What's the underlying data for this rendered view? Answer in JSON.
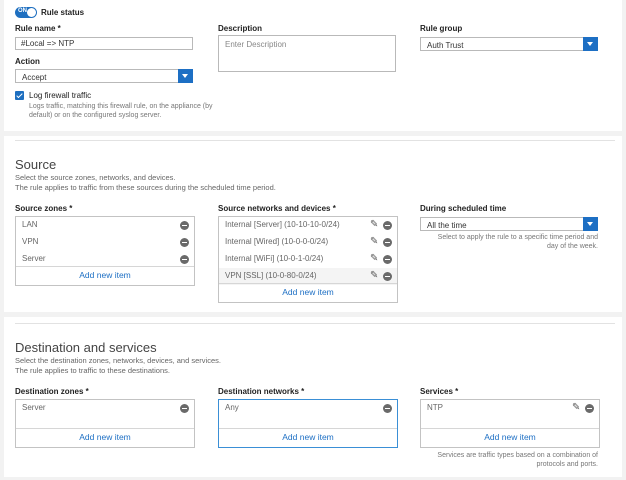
{
  "rule": {
    "status_toggle": "ON",
    "status_label": "Rule status",
    "name_label": "Rule name *",
    "name_value": "#Local => NTP",
    "description_label": "Description",
    "description_placeholder": "Enter Description",
    "group_label": "Rule group",
    "group_value": "Auth Trust",
    "action_label": "Action",
    "action_value": "Accept",
    "log_label": "Log firewall traffic",
    "log_help_1": "Logs traffic, matching this firewall rule, on the appliance (by",
    "log_help_2": "default) or on the configured syslog server."
  },
  "source": {
    "title": "Source",
    "desc_1": "Select the source zones, networks, and devices.",
    "desc_2": "The rule applies to traffic from these sources during the scheduled time period.",
    "zones_label": "Source zones *",
    "zones": [
      "LAN",
      "VPN",
      "Server"
    ],
    "networks_label": "Source networks and devices *",
    "networks": [
      "Internal [Server] (10-10-10-0/24)",
      "Internal [Wired] (10-0-0-0/24)",
      "Internal [WiFi] (10-0-1-0/24)",
      "VPN [SSL] (10-0-80-0/24)"
    ],
    "add_new": "Add new item",
    "schedule_label": "During scheduled time",
    "schedule_value": "All the time",
    "schedule_help_1": "Select to apply the rule to a specific time period and",
    "schedule_help_2": "day of the week."
  },
  "destination": {
    "title": "Destination and services",
    "desc_1": "Select the destination zones, networks, devices, and services.",
    "desc_2": "The rule applies to traffic to these destinations.",
    "zones_label": "Destination zones *",
    "zones": [
      "Server"
    ],
    "networks_label": "Destination networks *",
    "networks": [
      "Any"
    ],
    "services_label": "Services *",
    "services": [
      "NTP"
    ],
    "add_new": "Add new item",
    "services_help_1": "Services are traffic types based on a combination of",
    "services_help_2": "protocols and ports."
  }
}
